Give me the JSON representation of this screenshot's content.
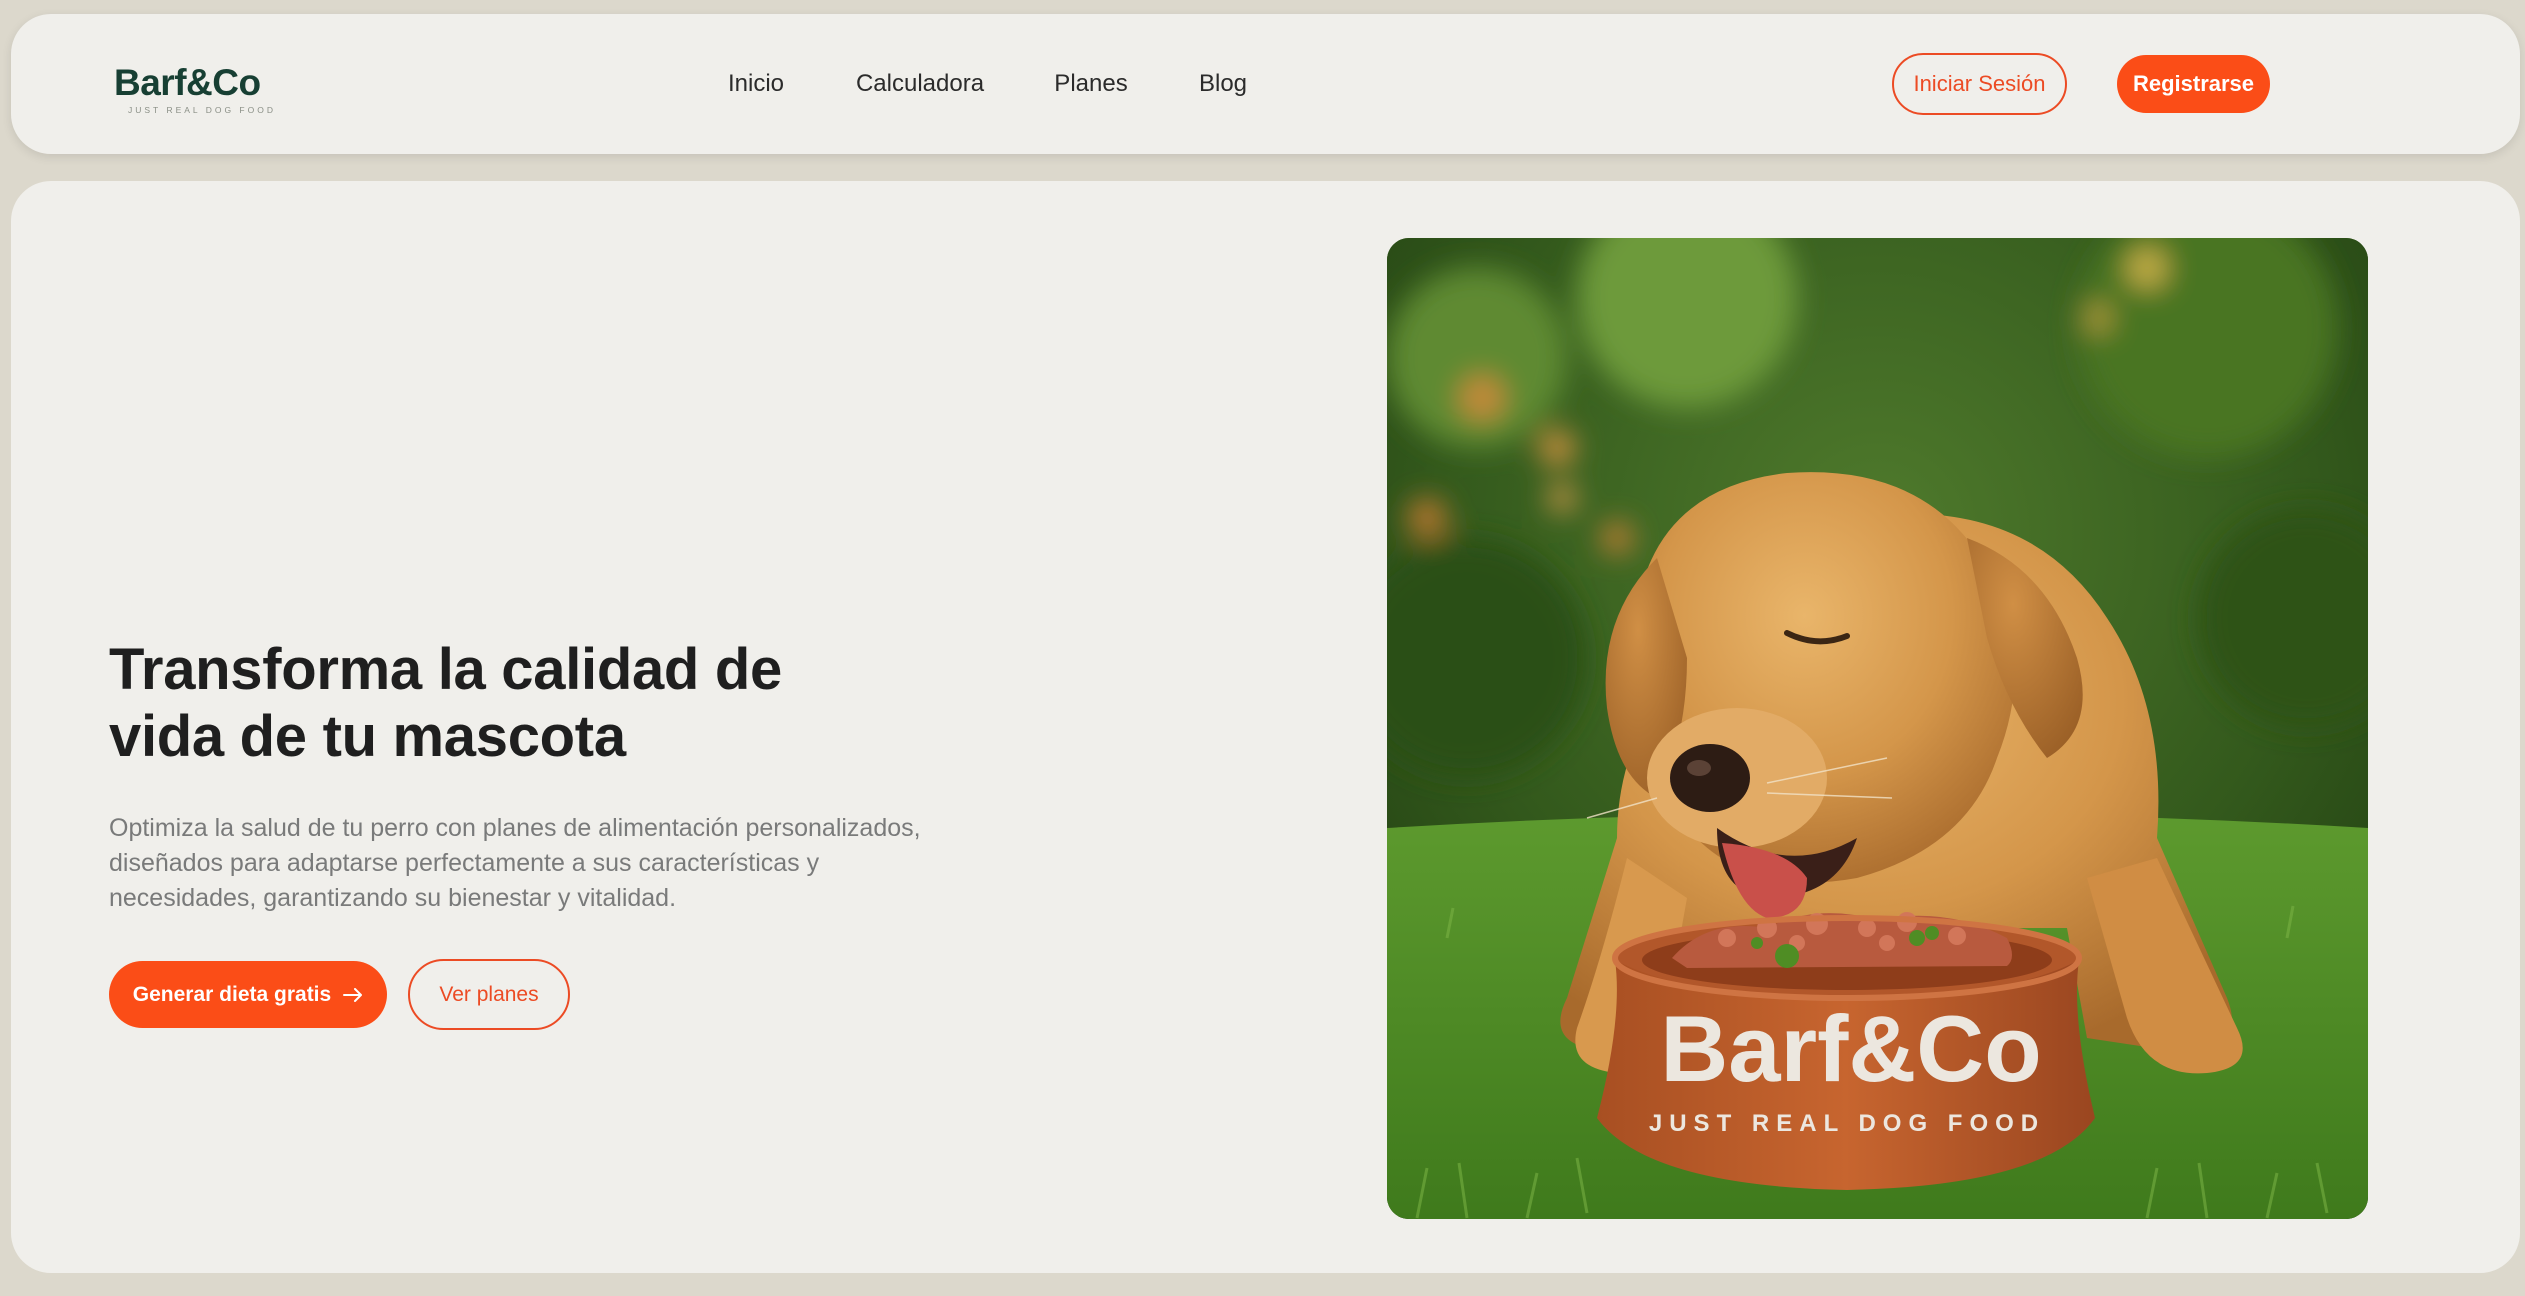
{
  "brand": {
    "name": "Barf&Co",
    "tagline": "JUST REAL DOG FOOD"
  },
  "nav": {
    "links": [
      "Inicio",
      "Calculadora",
      "Planes",
      "Blog"
    ],
    "login_label": "Iniciar Sesión",
    "register_label": "Registrarse"
  },
  "hero": {
    "title_line1": "Transforma la calidad de",
    "title_line2": "vida de tu mascota",
    "description": "Optimiza la salud de tu perro con planes de alimentación personalizados, diseñados para adaptarse perfectamente a sus características y necesidades, garantizando su bienestar y vitalidad.",
    "primary_cta": "Generar dieta gratis",
    "secondary_cta": "Ver planes",
    "image": {
      "subject": "golden-retriever-eating-from-bowl",
      "bowl_brand": "Barf&Co",
      "bowl_tagline": "JUST REAL DOG FOOD"
    }
  },
  "colors": {
    "accent": "#fb4d17",
    "brand_green": "#173f33",
    "background": "#dcd8cc",
    "card": "#f0efeb",
    "text_dark": "#1f1f1f",
    "text_muted": "#797a7a"
  }
}
